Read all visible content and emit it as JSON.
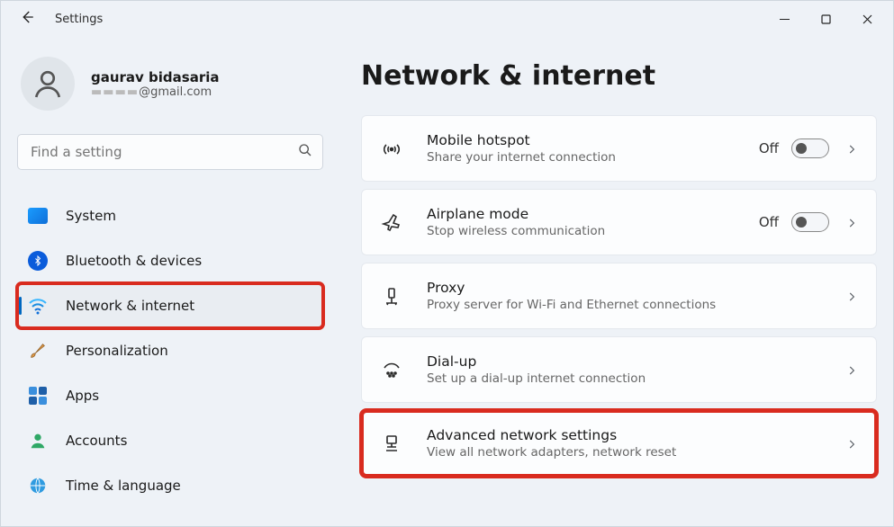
{
  "window": {
    "title": "Settings"
  },
  "user": {
    "name": "gaurav bidasaria",
    "email_suffix": "@gmail.com"
  },
  "search": {
    "placeholder": "Find a setting"
  },
  "sidebar": {
    "items": [
      {
        "label": "System"
      },
      {
        "label": "Bluetooth & devices"
      },
      {
        "label": "Network & internet"
      },
      {
        "label": "Personalization"
      },
      {
        "label": "Apps"
      },
      {
        "label": "Accounts"
      },
      {
        "label": "Time & language"
      }
    ]
  },
  "page": {
    "title": "Network & internet"
  },
  "cards": [
    {
      "title": "Mobile hotspot",
      "subtitle": "Share your internet connection",
      "status": "Off",
      "has_toggle": true
    },
    {
      "title": "Airplane mode",
      "subtitle": "Stop wireless communication",
      "status": "Off",
      "has_toggle": true
    },
    {
      "title": "Proxy",
      "subtitle": "Proxy server for Wi-Fi and Ethernet connections"
    },
    {
      "title": "Dial-up",
      "subtitle": "Set up a dial-up internet connection"
    },
    {
      "title": "Advanced network settings",
      "subtitle": "View all network adapters, network reset"
    }
  ]
}
